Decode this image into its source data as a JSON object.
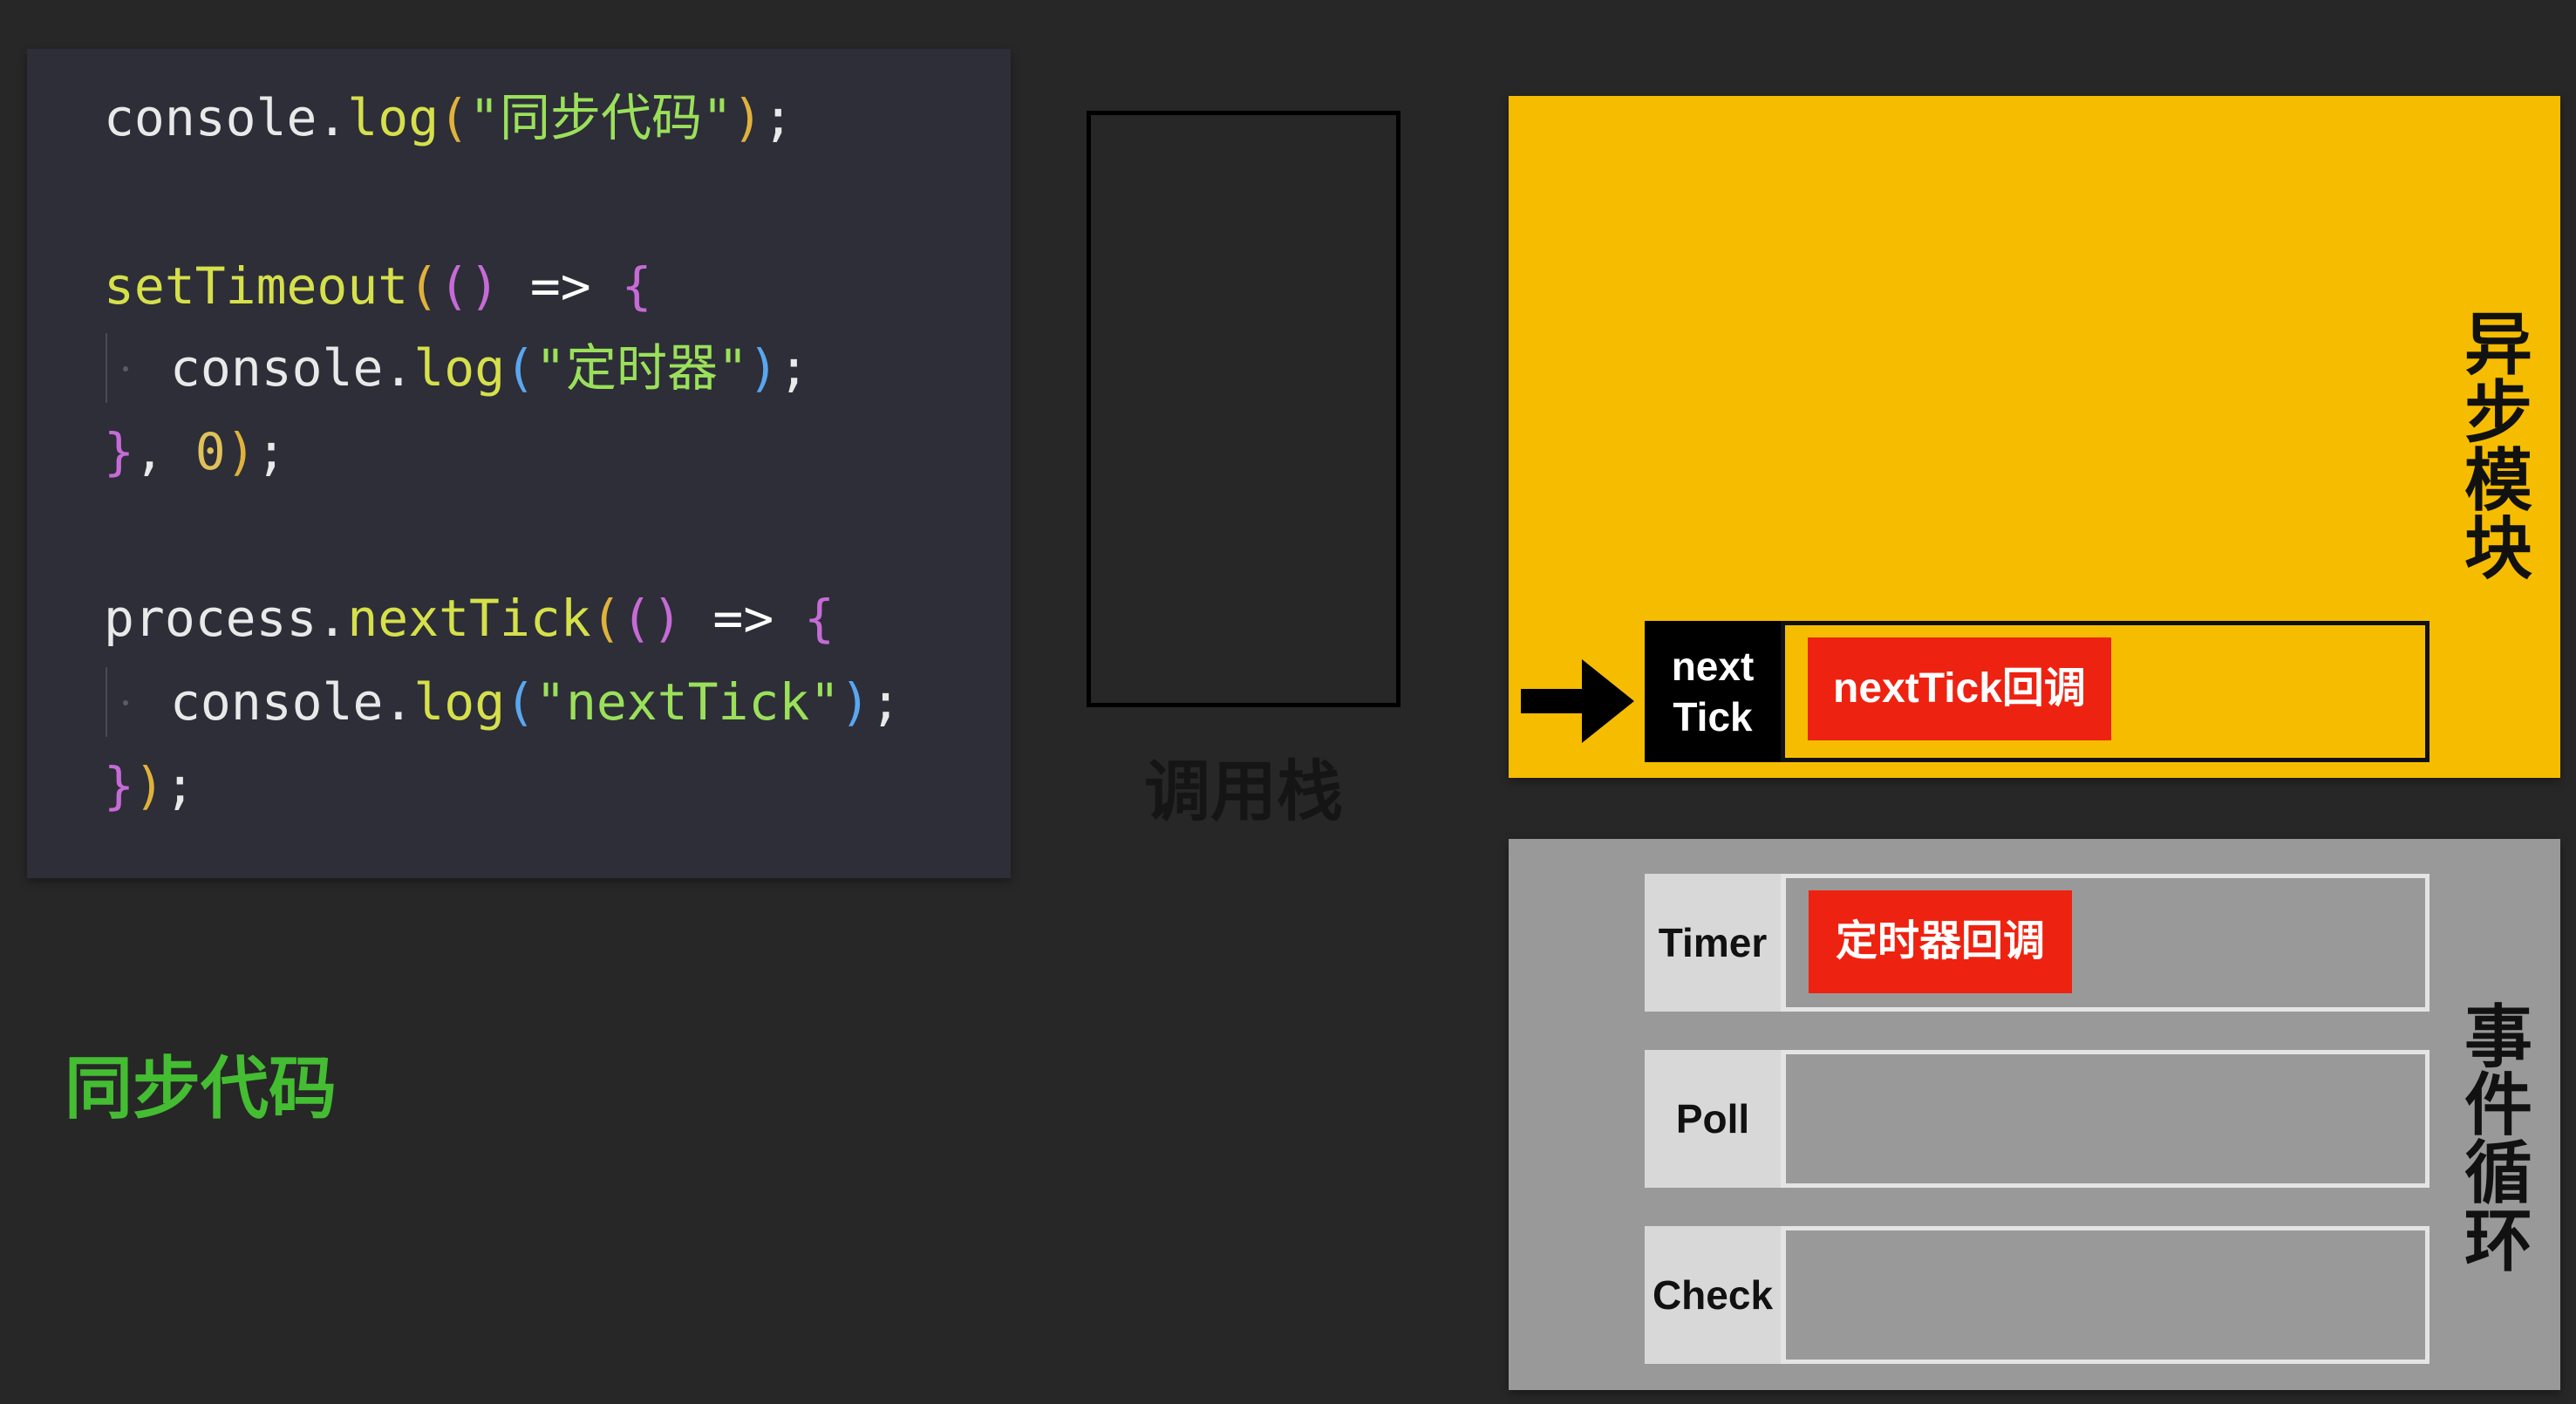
{
  "code": {
    "lines": [
      [
        [
          "c-obj",
          "console"
        ],
        [
          "c-pun",
          "."
        ],
        [
          "c-fn",
          "log"
        ],
        [
          "c-par1",
          "("
        ],
        [
          "c-str",
          "\"同步代码\""
        ],
        [
          "c-par1",
          ")"
        ],
        [
          "c-pun",
          ";"
        ]
      ],
      [],
      [
        [
          "c-fn",
          "setTimeout"
        ],
        [
          "c-par1",
          "("
        ],
        [
          "c-par2",
          "()"
        ],
        [
          "c-pun",
          " "
        ],
        [
          "c-arr",
          "=>"
        ],
        [
          "c-pun",
          " "
        ],
        [
          "c-par2",
          "{"
        ]
      ],
      [
        [
          "indent",
          ""
        ],
        [
          "c-obj",
          "console"
        ],
        [
          "c-pun",
          "."
        ],
        [
          "c-fn",
          "log"
        ],
        [
          "c-par3",
          "("
        ],
        [
          "c-str",
          "\"定时器\""
        ],
        [
          "c-par3",
          ")"
        ],
        [
          "c-pun",
          ";"
        ]
      ],
      [
        [
          "c-par2",
          "}"
        ],
        [
          "c-pun",
          ", "
        ],
        [
          "c-num",
          "0"
        ],
        [
          "c-par1",
          ")"
        ],
        [
          "c-pun",
          ";"
        ]
      ],
      [],
      [
        [
          "c-obj",
          "process"
        ],
        [
          "c-pun",
          "."
        ],
        [
          "c-fn",
          "nextTick"
        ],
        [
          "c-par1",
          "("
        ],
        [
          "c-par2",
          "()"
        ],
        [
          "c-pun",
          " "
        ],
        [
          "c-arr",
          "=>"
        ],
        [
          "c-pun",
          " "
        ],
        [
          "c-par2",
          "{"
        ]
      ],
      [
        [
          "indent",
          ""
        ],
        [
          "c-obj",
          "console"
        ],
        [
          "c-pun",
          "."
        ],
        [
          "c-fn",
          "log"
        ],
        [
          "c-par3",
          "("
        ],
        [
          "c-str",
          "\"nextTick\""
        ],
        [
          "c-par3",
          ")"
        ],
        [
          "c-pun",
          ";"
        ]
      ],
      [
        [
          "c-par2",
          "}"
        ],
        [
          "c-par1",
          ")"
        ],
        [
          "c-pun",
          ";"
        ]
      ]
    ]
  },
  "call_stack": {
    "label": "调用栈"
  },
  "sync_label": "同步代码",
  "async_module": {
    "label": "异步模块",
    "color": "#f6bc00",
    "nexttick": {
      "tag": "next\nTick",
      "callback": "nextTick回调"
    }
  },
  "event_loop": {
    "label": "事件循环",
    "color": "#999999",
    "phases": {
      "timer": {
        "tag": "Timer",
        "callback": "定时器回调"
      },
      "poll": {
        "tag": "Poll"
      },
      "check": {
        "tag": "Check"
      }
    }
  },
  "colors": {
    "background": "#272727",
    "code_background": "#2d2e38",
    "callback": "#ee2211",
    "sync_label": "#44bd32"
  },
  "icons": {
    "entry_arrow": "arrow-right-icon"
  }
}
